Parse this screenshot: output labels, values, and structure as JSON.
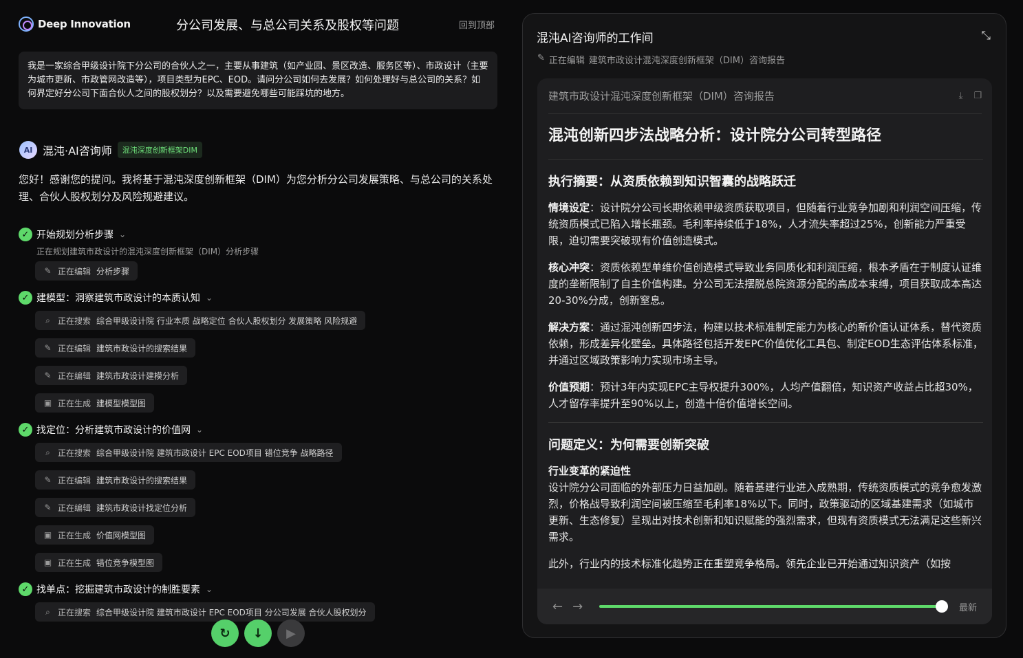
{
  "header": {
    "logo_text": "Deep Innovation",
    "title": "分公司发展、与总公司关系及股权等问题",
    "back_to_top": "回到顶部"
  },
  "question": "我是一家综合甲级设计院下分公司的合伙人之一，主要从事建筑（如产业园、景区改造、服务区等）、市政设计（主要为城市更新、市政管网改造等），项目类型为EPC、EOD。请问分公司如何去发展？如何处理好与总公司的关系？如何界定好分公司下面合伙人之间的股权划分？以及需要避免哪些可能踩坑的地方。",
  "assistant": {
    "avatar": "AI",
    "name": "混沌·AI咨询师",
    "badge": "混沌深度创新框架DIM",
    "intro": "您好！感谢您的提问。我将基于混沌深度创新框架（DIM）为您分析分公司发展策略、与总公司的关系处理、合伙人股权划分及风险规避建议。"
  },
  "steps": [
    {
      "title": "开始规划分析步骤",
      "desc": "正在规划建筑市政设计的混沌深度创新框架（DIM）分析步骤",
      "actions": [
        {
          "icon": "edit-icon",
          "verb": "正在编辑",
          "object": "分析步骤"
        }
      ]
    },
    {
      "title": "建模型：洞察建筑市政设计的本质认知",
      "desc": "",
      "actions": [
        {
          "icon": "search-icon",
          "verb": "正在搜索",
          "object": "综合甲级设计院 行业本质 战略定位 合伙人股权划分 发展策略 风险规避"
        },
        {
          "icon": "edit-icon",
          "verb": "正在编辑",
          "object": "建筑市政设计的搜索结果"
        },
        {
          "icon": "edit-icon",
          "verb": "正在编辑",
          "object": "建筑市政设计建模分析"
        },
        {
          "icon": "image-icon",
          "verb": "正在生成",
          "object": "建模型模型图"
        }
      ]
    },
    {
      "title": "找定位：分析建筑市政设计的价值网",
      "desc": "",
      "actions": [
        {
          "icon": "search-icon",
          "verb": "正在搜索",
          "object": "综合甲级设计院 建筑市政设计 EPC EOD项目 错位竞争 战略路径"
        },
        {
          "icon": "edit-icon",
          "verb": "正在编辑",
          "object": "建筑市政设计的搜索结果"
        },
        {
          "icon": "edit-icon",
          "verb": "正在编辑",
          "object": "建筑市政设计找定位分析"
        },
        {
          "icon": "image-icon",
          "verb": "正在生成",
          "object": "价值网模型图"
        },
        {
          "icon": "image-icon",
          "verb": "正在生成",
          "object": "错位竞争模型图"
        }
      ]
    },
    {
      "title": "找单点：挖掘建筑市政设计的制胜要素",
      "desc": "",
      "actions": [
        {
          "icon": "search-icon",
          "verb": "正在搜索",
          "object": "综合甲级设计院 建筑市政设计 EPC EOD项目 分公司发展 合伙人股权划分"
        }
      ]
    }
  ],
  "workspace": {
    "title": "混沌AI咨询师的工作间",
    "sub_verb": "正在编辑",
    "sub_object": "建筑市政设计混沌深度创新框架（DIM）咨询报告",
    "doc_title": "建筑市政设计混沌深度创新框架（DIM）咨询报告",
    "h1": "混沌创新四步法战略分析：设计院分公司转型路径",
    "section1_title": "执行摘要：从资质依赖到知识智囊的战略跃迁",
    "paras": [
      {
        "label": "情境设定",
        "text": "：设计院分公司长期依赖甲级资质获取项目，但随着行业竞争加剧和利润空间压缩，传统资质模式已陷入增长瓶颈。毛利率持续低于18%，人才流失率超过25%，创新能力严重受限，迫切需要突破现有价值创造模式。"
      },
      {
        "label": "核心冲突",
        "text": "：资质依赖型单维价值创造模式导致业务同质化和利润压缩，根本矛盾在于制度认证维度的垄断限制了自主价值构建。分公司无法摆脱总院资源分配的高成本束缚，项目获取成本高达20-30%分成，创新窒息。"
      },
      {
        "label": "解决方案",
        "text": "：通过混沌创新四步法，构建以技术标准制定能力为核心的新价值认证体系，替代资质依赖，形成差异化壁垒。具体路径包括开发EPC价值优化工具包、制定EOD生态评估体系标准，并通过区域政策影响力实现市场主导。"
      },
      {
        "label": "价值预期",
        "text": "：预计3年内实现EPC主导权提升300%，人均产值翻倍，知识资产收益占比超30%，人才留存率提升至90%以上，创造十倍价值增长空间。"
      }
    ],
    "section2_title": "问题定义：为何需要创新突破",
    "sub_heading": "行业变革的紧迫性",
    "para2": "设计院分公司面临的外部压力日益加剧。随着基建行业进入成熟期，传统资质模式的竞争愈发激烈，价格战导致利润空间被压缩至毛利率18%以下。同时，政策驱动的区域基建需求（如城市更新、生态修复）呈现出对技术创新和知识赋能的强烈需求，但现有资质模式无法满足这些新兴需求。",
    "para3": "此外，行业内的技术标准化趋势正在重塑竞争格局。领先企业已开始通过知识资产（如按",
    "progress": 0.99,
    "latest_label": "最新"
  },
  "colors": {
    "accent": "#5ed96a",
    "panel": "#1e1e20"
  }
}
